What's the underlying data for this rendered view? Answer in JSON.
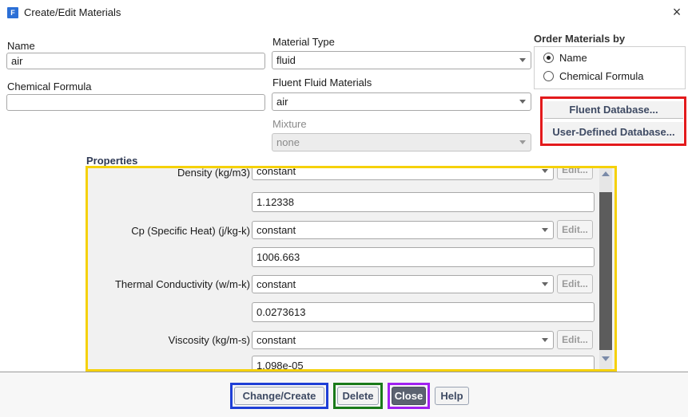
{
  "window": {
    "title": "Create/Edit Materials",
    "icon_letter": "F",
    "close_glyph": "×"
  },
  "name": {
    "label": "Name",
    "value": "air"
  },
  "chemical_formula": {
    "label": "Chemical Formula",
    "value": ""
  },
  "material_type": {
    "label": "Material Type",
    "value": "fluid"
  },
  "fluent_fluid_materials": {
    "label": "Fluent Fluid Materials",
    "value": "air"
  },
  "mixture": {
    "label": "Mixture",
    "value": "none"
  },
  "order_by": {
    "title": "Order Materials by",
    "options": [
      {
        "label": "Name",
        "checked": true
      },
      {
        "label": "Chemical Formula",
        "checked": false
      }
    ]
  },
  "database_buttons": {
    "fluent": "Fluent Database...",
    "user_defined": "User-Defined Database..."
  },
  "properties": {
    "title": "Properties",
    "rows": [
      {
        "label": "Density (kg/m3)",
        "method": "constant",
        "value": "1.12338",
        "edit": "Edit..."
      },
      {
        "label": "Cp (Specific Heat) (j/kg-k)",
        "method": "constant",
        "value": "1006.663",
        "edit": "Edit..."
      },
      {
        "label": "Thermal Conductivity (w/m-k)",
        "method": "constant",
        "value": "0.0273613",
        "edit": "Edit..."
      },
      {
        "label": "Viscosity (kg/m-s)",
        "method": "constant",
        "value": "1.098e-05",
        "edit": "Edit..."
      }
    ]
  },
  "actions": {
    "change_create": "Change/Create",
    "delete": "Delete",
    "close": "Close",
    "help": "Help"
  },
  "highlight_colors": {
    "database_box": "#e31a1c",
    "properties_box": "#f5d10a",
    "change_create_box": "#1f3fd6",
    "delete_box": "#1a7a1a",
    "close_box": "#a020f0"
  }
}
